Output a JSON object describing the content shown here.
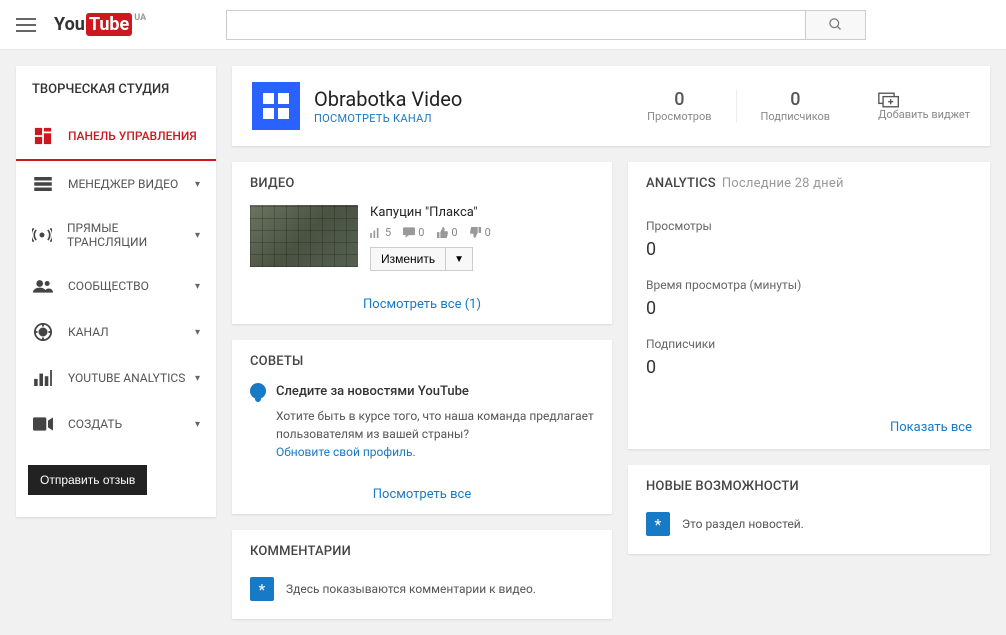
{
  "header": {
    "logo_country": "UA",
    "search_placeholder": ""
  },
  "sidebar": {
    "title": "ТВОРЧЕСКАЯ СТУДИЯ",
    "items": [
      {
        "label": "ПАНЕЛЬ УПРАВЛЕНИЯ",
        "active": true,
        "expandable": false
      },
      {
        "label": "МЕНЕДЖЕР ВИДЕО",
        "active": false,
        "expandable": true
      },
      {
        "label": "ПРЯМЫЕ ТРАНСЛЯЦИИ",
        "active": false,
        "expandable": true
      },
      {
        "label": "СООБЩЕСТВО",
        "active": false,
        "expandable": true
      },
      {
        "label": "КАНАЛ",
        "active": false,
        "expandable": true
      },
      {
        "label": "YOUTUBE ANALYTICS",
        "active": false,
        "expandable": true
      },
      {
        "label": "СОЗДАТЬ",
        "active": false,
        "expandable": true
      }
    ],
    "feedback": "Отправить отзыв"
  },
  "channel": {
    "name": "Obrabotka Video",
    "view_link": "ПОСМОТРЕТЬ КАНАЛ",
    "stats": [
      {
        "value": "0",
        "label": "Просмотров"
      },
      {
        "value": "0",
        "label": "Подписчиков"
      }
    ],
    "add_widget": "Добавить виджет"
  },
  "videos": {
    "title": "ВИДЕО",
    "item": {
      "title": "Капуцин \"Плакса\"",
      "views": "5",
      "comments": "0",
      "likes": "0",
      "dislikes": "0",
      "edit": "Изменить"
    },
    "footer": "Посмотреть все (1)"
  },
  "tips": {
    "title": "СОВЕТЫ",
    "head": "Следите за новостями YouTube",
    "body": "Хотите быть в курсе того, что наша команда предлагает пользователям из вашей страны?",
    "link": "Обновите свой профиль.",
    "footer": "Посмотреть все"
  },
  "comments": {
    "title": "КОММЕНТАРИИ",
    "text": "Здесь показываются комментарии к видео."
  },
  "analytics": {
    "title": "ANALYTICS",
    "period": "Последние 28 дней",
    "metrics": [
      {
        "label": "Просмотры",
        "value": "0"
      },
      {
        "label": "Время просмотра (минуты)",
        "value": "0"
      },
      {
        "label": "Подписчики",
        "value": "0"
      }
    ],
    "show_all": "Показать все"
  },
  "news": {
    "title": "НОВЫЕ ВОЗМОЖНОСТИ",
    "text": "Это раздел новостей."
  }
}
